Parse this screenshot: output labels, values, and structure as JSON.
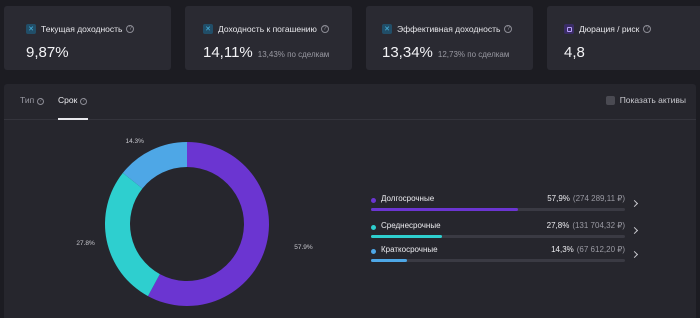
{
  "cards": [
    {
      "title": "Текущая доходность",
      "value": "9,87%",
      "sub": "",
      "icon": "close-icon"
    },
    {
      "title": "Доходность к погашению",
      "value": "14,11%",
      "sub": "13,43% по сделкам",
      "icon": "close-icon"
    },
    {
      "title": "Эффективная доходность",
      "value": "13,34%",
      "sub": "12,73% по сделкам",
      "icon": "close-icon"
    },
    {
      "title": "Дюрация / риск",
      "value": "4,8",
      "sub": "",
      "icon": "calendar-icon"
    }
  ],
  "tabs": [
    {
      "label": "Тип"
    },
    {
      "label": "Срок"
    }
  ],
  "active_tab": "Срок",
  "toggle": {
    "label": "Показать активы",
    "checked": false
  },
  "chart_data": {
    "type": "pie",
    "style": "donut",
    "labels": [
      "Долгосрочные",
      "Среднесрочные",
      "Краткосрочные"
    ],
    "values": [
      57.9,
      27.8,
      14.3
    ],
    "slice_labels": [
      "57.9%",
      "27.8%",
      "14.3%"
    ],
    "colors": [
      "#6b35d1",
      "#2ecfcf",
      "#4ea7e6"
    ]
  },
  "legend": [
    {
      "name": "Долгосрочные",
      "pct": "57,9%",
      "amount": "(274 289,11 ₽)",
      "fraction": 0.579,
      "color": "#6b35d1"
    },
    {
      "name": "Среднесрочные",
      "pct": "27,8%",
      "amount": "(131 704,32 ₽)",
      "fraction": 0.278,
      "color": "#2ecfcf"
    },
    {
      "name": "Краткосрочные",
      "pct": "14,3%",
      "amount": "(67 612,20 ₽)",
      "fraction": 0.143,
      "color": "#4ea7e6"
    }
  ]
}
